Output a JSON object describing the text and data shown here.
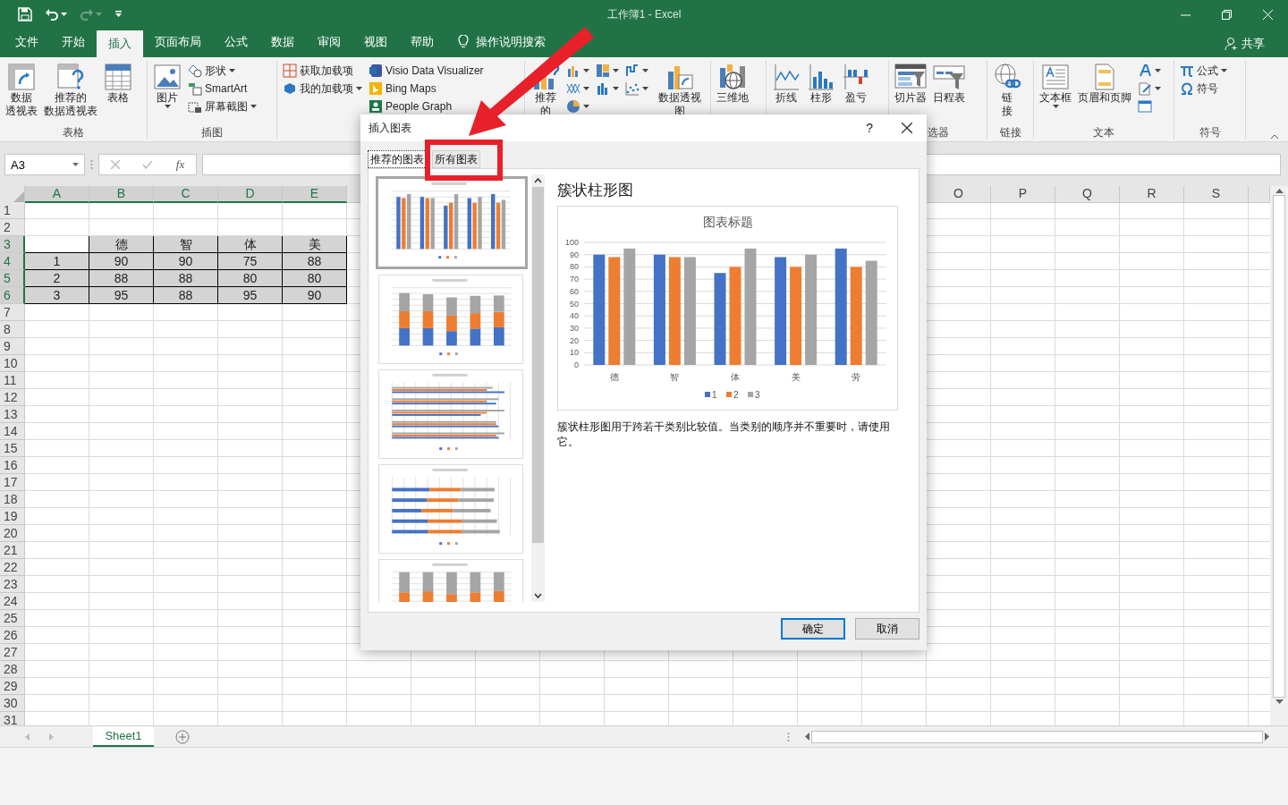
{
  "window": {
    "title": "工作簿1  -  Excel",
    "redo_disabled": true
  },
  "menu_tabs": [
    {
      "label": "文件",
      "selected": false
    },
    {
      "label": "开始",
      "selected": false
    },
    {
      "label": "插入",
      "selected": true
    },
    {
      "label": "页面布局",
      "selected": false
    },
    {
      "label": "公式",
      "selected": false
    },
    {
      "label": "数据",
      "selected": false
    },
    {
      "label": "审阅",
      "selected": false
    },
    {
      "label": "视图",
      "selected": false
    },
    {
      "label": "帮助",
      "selected": false
    }
  ],
  "tell_me": "操作说明搜索",
  "share": "共享",
  "ribbon": {
    "groups": [
      {
        "label": "表格",
        "columns": [
          [
            {
              "kind": "large",
              "lines": [
                "数据",
                "透视表"
              ]
            }
          ],
          [
            {
              "kind": "large",
              "lines": [
                "推荐的",
                "数据透视表"
              ]
            }
          ],
          [
            {
              "kind": "large",
              "lines": [
                "表格"
              ]
            }
          ]
        ]
      },
      {
        "label": "插图",
        "columns": [
          [
            {
              "kind": "large",
              "lines": [
                "图片"
              ],
              "dropdown": true
            }
          ],
          [
            {
              "kind": "small",
              "text": "形状",
              "dropdown": true
            },
            {
              "kind": "small",
              "text": "SmartArt"
            },
            {
              "kind": "small",
              "text": "屏幕截图",
              "dropdown": true
            }
          ]
        ]
      },
      {
        "columns": [
          [
            {
              "kind": "small",
              "text": "获取加载项"
            },
            {
              "kind": "small",
              "text": "我的加载项",
              "dropdown": true
            }
          ],
          [
            {
              "kind": "small",
              "text": "Visio Data Visualizer"
            },
            {
              "kind": "small",
              "text": "Bing Maps"
            },
            {
              "kind": "small",
              "text": "People Graph"
            }
          ]
        ]
      },
      {
        "columns": [
          [
            {
              "kind": "large",
              "lines": [
                "推荐的"
              ]
            }
          ],
          [
            {
              "kind": "icon",
              "dropdown": true
            },
            {
              "kind": "icon",
              "dropdown": true
            },
            {
              "kind": "icon",
              "dropdown": true
            }
          ],
          [
            {
              "kind": "icon",
              "dropdown": true
            },
            {
              "kind": "icon",
              "dropdown": true
            }
          ],
          [
            {
              "kind": "icon",
              "dropdown": true
            },
            {
              "kind": "icon",
              "dropdown": true
            }
          ],
          [
            {
              "kind": "large",
              "lines": [
                "数据透视图"
              ],
              "dropdown": true
            }
          ]
        ]
      },
      {
        "columns": [
          [
            {
              "kind": "large",
              "lines": [
                "三维地"
              ]
            }
          ]
        ]
      },
      {
        "columns": [
          [
            {
              "kind": "large",
              "lines": [
                "折线"
              ]
            }
          ],
          [
            {
              "kind": "large",
              "lines": [
                "柱形"
              ]
            }
          ],
          [
            {
              "kind": "large",
              "lines": [
                "盈亏"
              ]
            }
          ]
        ]
      },
      {
        "label": "选器",
        "columns": [
          [
            {
              "kind": "large",
              "lines": [
                "切片器"
              ]
            }
          ],
          [
            {
              "kind": "large",
              "lines": [
                "日程表"
              ]
            }
          ]
        ]
      },
      {
        "label": "链接",
        "columns": [
          [
            {
              "kind": "large",
              "lines": [
                "链",
                "接"
              ]
            }
          ]
        ]
      },
      {
        "label": "文本",
        "columns": [
          [
            {
              "kind": "large",
              "lines": [
                "文本框"
              ],
              "dropdown": true
            }
          ],
          [
            {
              "kind": "large",
              "lines": [
                "页眉和页脚"
              ]
            }
          ],
          [
            {
              "kind": "icon",
              "dropdown": true
            },
            {
              "kind": "icon",
              "dropdown": true
            },
            {
              "kind": "icon"
            }
          ]
        ]
      },
      {
        "label": "符号",
        "columns": [
          [
            {
              "kind": "small",
              "text": "公式",
              "dropdown": true
            },
            {
              "kind": "small",
              "text": "符号"
            }
          ]
        ]
      }
    ]
  },
  "formula_bar": {
    "name_box": "A3",
    "function_label": "fx"
  },
  "sheet": {
    "columns_left": [
      {
        "label": "A",
        "selected": true
      },
      {
        "label": "B",
        "selected": true
      },
      {
        "label": "C",
        "selected": true
      },
      {
        "label": "D",
        "selected": true
      },
      {
        "label": "E",
        "selected": true
      }
    ],
    "columns_right": [
      {
        "label": "O",
        "selected": false
      },
      {
        "label": "P",
        "selected": false
      },
      {
        "label": "Q",
        "selected": false
      },
      {
        "label": "R",
        "selected": false
      },
      {
        "label": "S",
        "selected": false
      }
    ],
    "rows": [
      {
        "label": "1",
        "selected": false
      },
      {
        "label": "2",
        "selected": false
      },
      {
        "label": "3",
        "selected": true,
        "cells": [
          {
            "active": true
          },
          {
            "value": "德",
            "active": false
          },
          {
            "value": "智",
            "active": false
          },
          {
            "value": "体",
            "active": false
          },
          {
            "value": "美",
            "active": false
          }
        ]
      },
      {
        "label": "4",
        "selected": true,
        "cells": [
          {
            "value": "1",
            "active": false
          },
          {
            "value": "90",
            "active": false
          },
          {
            "value": "90",
            "active": false
          },
          {
            "value": "75",
            "active": false
          },
          {
            "value": "88",
            "active": false
          }
        ]
      },
      {
        "label": "5",
        "selected": true,
        "cells": [
          {
            "value": "2",
            "active": false
          },
          {
            "value": "88",
            "active": false
          },
          {
            "value": "88",
            "active": false
          },
          {
            "value": "80",
            "active": false
          },
          {
            "value": "80",
            "active": false
          }
        ]
      },
      {
        "label": "6",
        "selected": true,
        "cells": [
          {
            "value": "3",
            "active": false
          },
          {
            "value": "95",
            "active": false
          },
          {
            "value": "88",
            "active": false
          },
          {
            "value": "95",
            "active": false
          },
          {
            "value": "90",
            "active": false
          }
        ]
      },
      {
        "label": "7",
        "selected": false
      },
      {
        "label": "8",
        "selected": false
      },
      {
        "label": "9",
        "selected": false
      },
      {
        "label": "10",
        "selected": false
      },
      {
        "label": "11",
        "selected": false
      },
      {
        "label": "12",
        "selected": false
      },
      {
        "label": "13",
        "selected": false
      },
      {
        "label": "14",
        "selected": false
      },
      {
        "label": "15",
        "selected": false
      },
      {
        "label": "16",
        "selected": false
      },
      {
        "label": "17",
        "selected": false
      },
      {
        "label": "18",
        "selected": false
      },
      {
        "label": "19",
        "selected": false
      },
      {
        "label": "20",
        "selected": false
      },
      {
        "label": "21",
        "selected": false
      },
      {
        "label": "22",
        "selected": false
      },
      {
        "label": "23",
        "selected": false
      },
      {
        "label": "24",
        "selected": false
      },
      {
        "label": "25",
        "selected": false
      },
      {
        "label": "26",
        "selected": false
      },
      {
        "label": "27",
        "selected": false
      },
      {
        "label": "28",
        "selected": false
      },
      {
        "label": "29",
        "selected": false
      },
      {
        "label": "30",
        "selected": false
      },
      {
        "label": "31",
        "selected": false
      }
    ]
  },
  "sheet_tabs": [
    {
      "label": "Sheet1",
      "selected": true
    }
  ],
  "dialog": {
    "title": "插入图表",
    "help": "?",
    "tabs": [
      {
        "label": "推荐的图表",
        "selected": true
      },
      {
        "label": "所有图表",
        "selected": false
      }
    ],
    "thumbnails": [
      {
        "kind": "clustered-column",
        "selected": true
      },
      {
        "kind": "stacked-column",
        "selected": false
      },
      {
        "kind": "clustered-bar",
        "selected": false
      },
      {
        "kind": "stacked-bar",
        "selected": false
      },
      {
        "kind": "percent-column",
        "selected": false
      }
    ],
    "preview": {
      "heading": "簇状柱形图",
      "chart_data": {
        "type": "bar",
        "title": "图表标题",
        "categories": [
          "德",
          "智",
          "体",
          "美",
          "劳"
        ],
        "series": [
          {
            "name": "1",
            "color": "#4472c4",
            "values": [
              90,
              90,
              75,
              88,
              95
            ]
          },
          {
            "name": "2",
            "color": "#ed7d31",
            "values": [
              88,
              88,
              80,
              80,
              80
            ]
          },
          {
            "name": "3",
            "color": "#a5a5a5",
            "values": [
              95,
              88,
              95,
              90,
              85
            ]
          }
        ],
        "ylim": [
          0,
          100
        ],
        "yticks": [
          0,
          10,
          20,
          30,
          40,
          50,
          60,
          70,
          80,
          90,
          100
        ],
        "grid": true,
        "legend": true
      },
      "description": "簇状柱形图用于跨若干类别比较值。当类别的顺序并不重要时，请使用它。"
    },
    "buttons": [
      {
        "label": "确定",
        "primary": true
      },
      {
        "label": "取消",
        "primary": false
      }
    ]
  }
}
